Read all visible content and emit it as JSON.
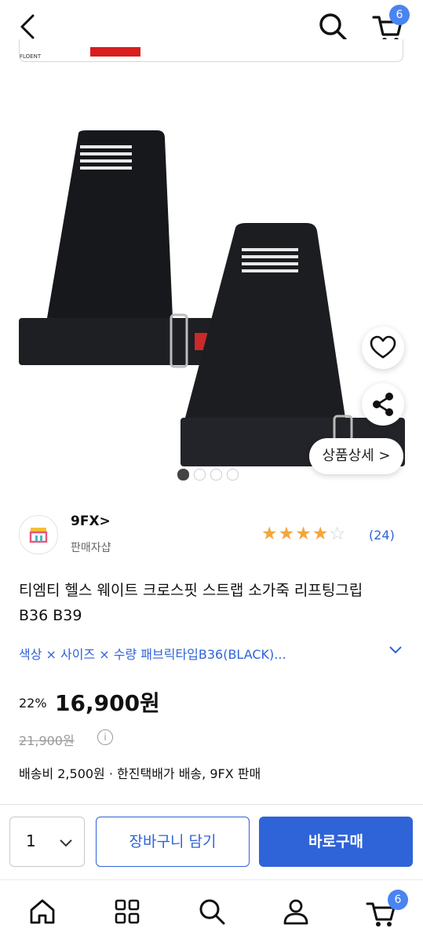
{
  "header": {
    "cart_badge": "6",
    "icons": [
      "back-icon",
      "search-icon",
      "cart-icon"
    ]
  },
  "ad_strip": {
    "logo_text": "FLOENT"
  },
  "gallery": {
    "detail_button": "상품상세 >",
    "active_slide": 1,
    "slide_count": 4
  },
  "seller": {
    "name": "9FX>",
    "type": "판매자샵",
    "rating": 4,
    "rating_max": 5,
    "review_count": "(24)"
  },
  "product": {
    "title": "티엠티 헬스 웨이트 크로스핏 스트랩 소가죽 리프팅그립 B36 B39",
    "options": "색상 × 사이즈 × 수량  패브릭타입B36(BLACK)...",
    "discount": "22%",
    "price": "16,900원",
    "original_price": "21,900원",
    "shipping": "배송비 2,500원 · 한진택배가 배송, 9FX 판매"
  },
  "purchase": {
    "quantity": "1",
    "cart_button": "장바구니 담기",
    "buy_button": "바로구매"
  },
  "bottom_nav": {
    "items": [
      "home-icon",
      "category-icon",
      "search-icon",
      "my-icon",
      "cart-icon"
    ],
    "cart_badge": "6"
  },
  "colors": {
    "accent": "#2f63d8",
    "badge": "#4a84f0",
    "star": "#f4a63b"
  }
}
